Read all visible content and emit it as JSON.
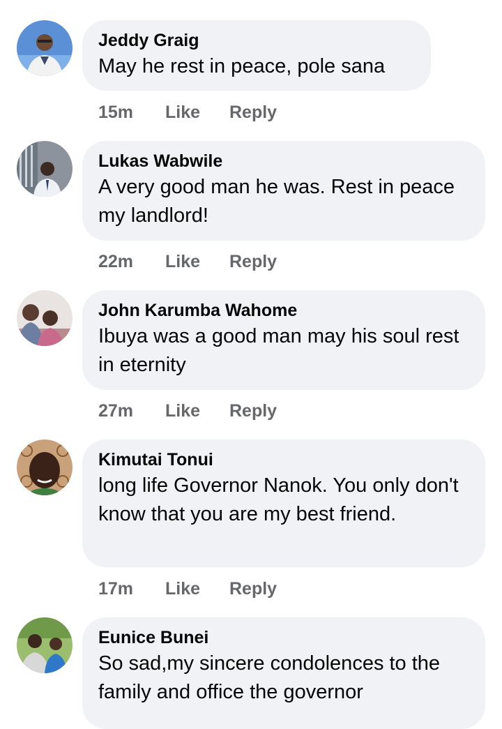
{
  "comments": [
    {
      "author": "Jeddy Graig",
      "text": "May he rest in peace, pole sana",
      "time": "15m",
      "like_label": "Like",
      "reply_label": "Reply"
    },
    {
      "author": "Lukas Wabwile",
      "text": "A very good man he was. Rest in peace my landlord!",
      "time": "22m",
      "like_label": "Like",
      "reply_label": "Reply"
    },
    {
      "author": "John Karumba Wahome",
      "text": "Ibuya was a good man may his soul rest in eternity",
      "time": "27m",
      "like_label": "Like",
      "reply_label": "Reply"
    },
    {
      "author": "Kimutai Tonui",
      "text": "long life Governor Nanok. You only don't know that you are my best friend.",
      "time": "17m",
      "like_label": "Like",
      "reply_label": "Reply"
    },
    {
      "author": "Eunice Bunei",
      "text": "So sad,my sincere condolences to the family and office the governor",
      "time": "",
      "like_label": "",
      "reply_label": ""
    }
  ],
  "colors": {
    "bubble": "#f0f2f5",
    "text": "#050505",
    "meta": "#65676b"
  }
}
